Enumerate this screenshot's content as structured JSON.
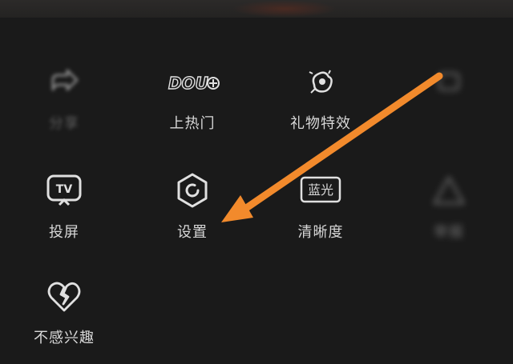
{
  "share_sheet": {
    "items": [
      {
        "label": "分享",
        "icon": "share-icon"
      },
      {
        "label": "上热门",
        "icon": "dou-plus-icon",
        "icon_text": "DOU"
      },
      {
        "label": "礼物特效",
        "icon": "gift-effect-icon"
      },
      {
        "label": "",
        "icon": "blurred-icon"
      },
      {
        "label": "投屏",
        "icon": "tv-cast-icon",
        "icon_text": "TV"
      },
      {
        "label": "设置",
        "icon": "settings-hexagon-icon"
      },
      {
        "label": "清晰度",
        "icon": "resolution-icon",
        "icon_text": "蓝光"
      },
      {
        "label": "举报",
        "icon": "report-icon"
      },
      {
        "label": "不感兴趣",
        "icon": "broken-heart-icon"
      }
    ]
  },
  "annotation": {
    "arrow_color": "#f28a2c",
    "arrow_target": "设置"
  },
  "colors": {
    "background": "#1a1a1a",
    "text": "#d8d8d8",
    "icon_stroke": "#e0e0e0"
  }
}
